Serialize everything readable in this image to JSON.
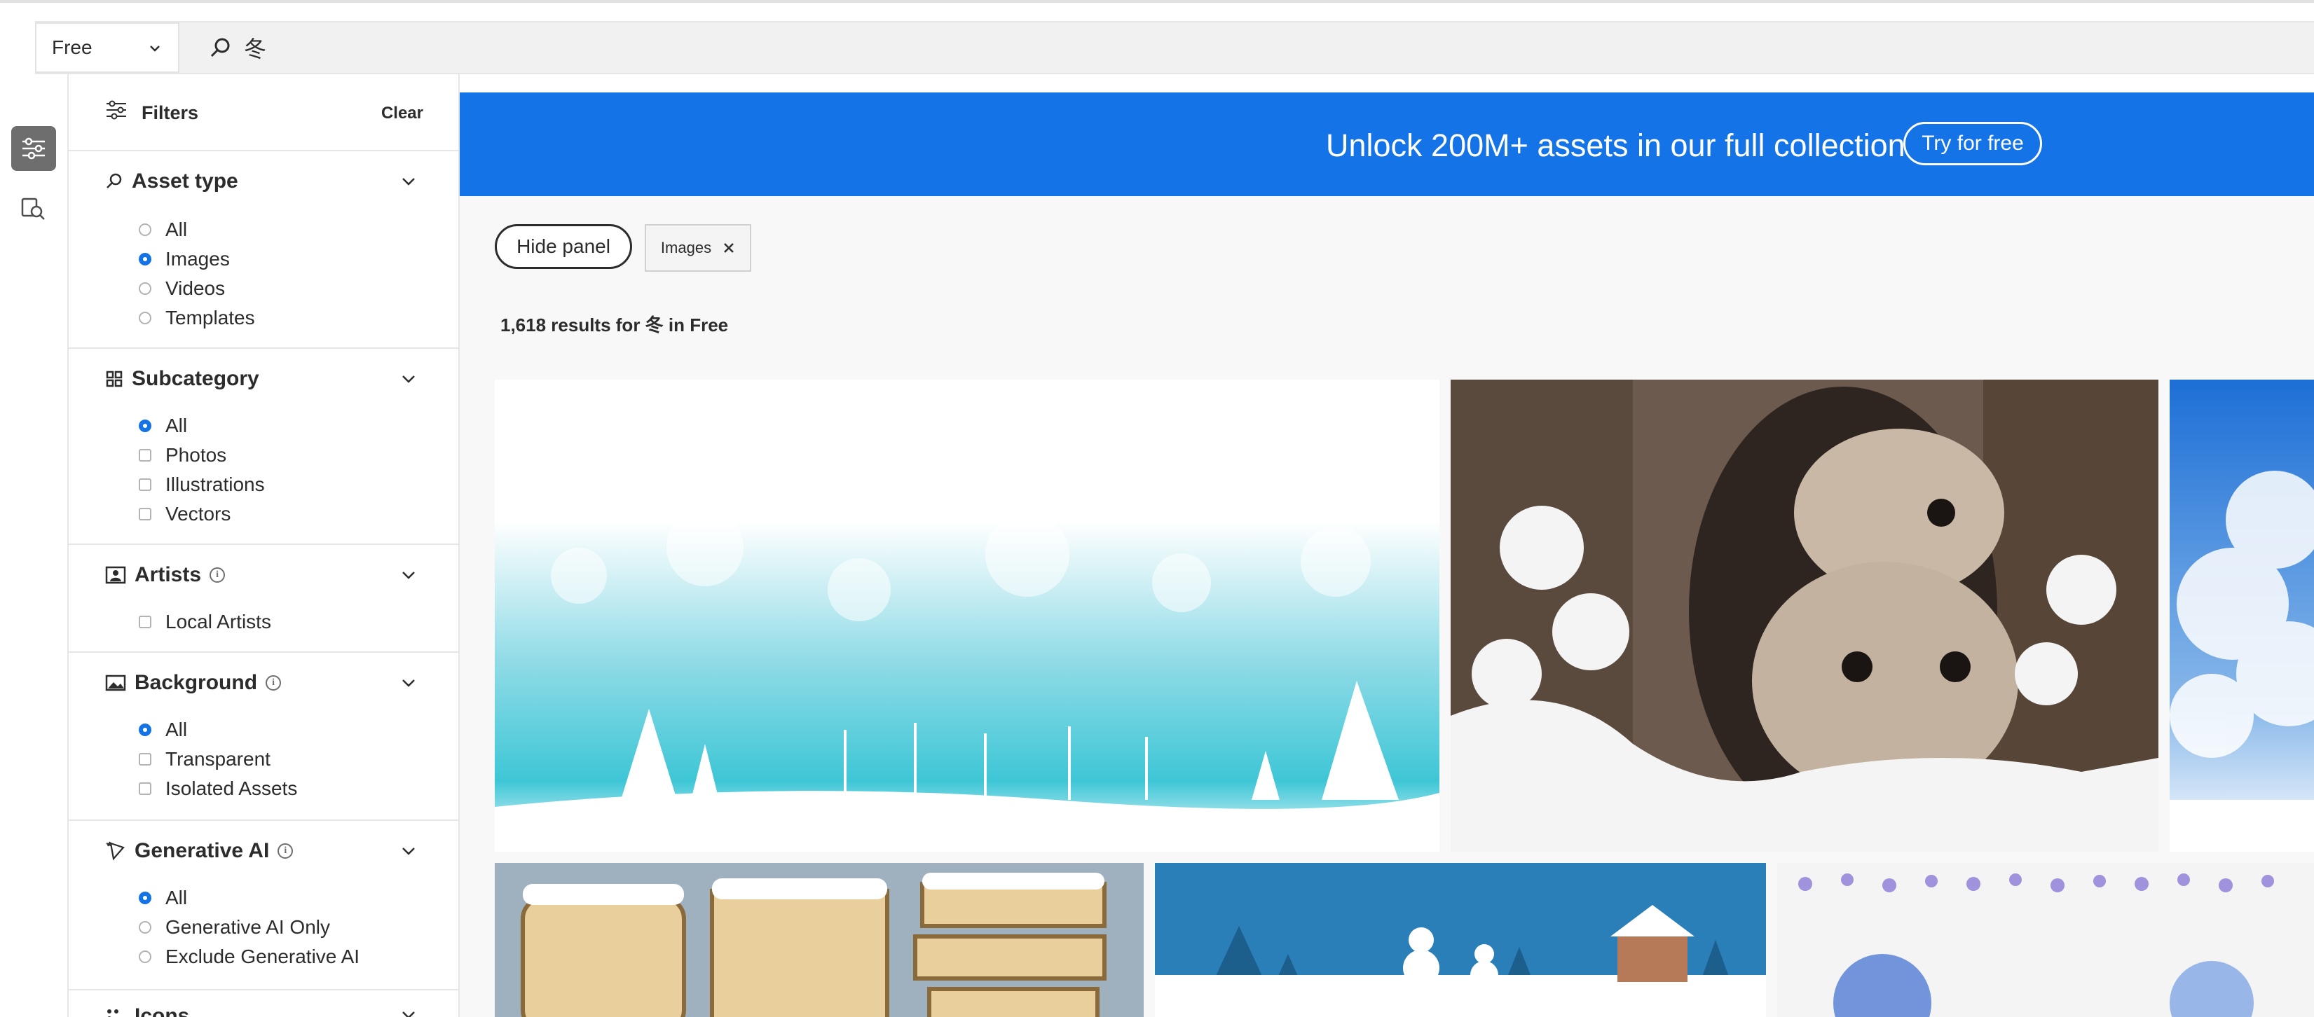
{
  "search": {
    "scope_label": "Free",
    "query": "冬"
  },
  "rail": {
    "filters_icon": "sliders-icon",
    "visual_search_icon": "image-search-icon"
  },
  "filters": {
    "title": "Filters",
    "clear_label": "Clear",
    "sections": {
      "asset_type": {
        "title": "Asset type",
        "options": [
          "All",
          "Images",
          "Videos",
          "Templates"
        ],
        "selected": "Images"
      },
      "subcategory": {
        "title": "Subcategory",
        "options": [
          "All",
          "Photos",
          "Illustrations",
          "Vectors"
        ],
        "selected": "All"
      },
      "artists": {
        "title": "Artists",
        "options": [
          "Local Artists"
        ]
      },
      "background": {
        "title": "Background",
        "options": [
          "All",
          "Transparent",
          "Isolated Assets"
        ],
        "selected": "All"
      },
      "generative_ai": {
        "title": "Generative AI",
        "options": [
          "All",
          "Generative AI Only",
          "Exclude Generative AI"
        ],
        "selected": "All"
      },
      "icons": {
        "title": "Icons"
      }
    }
  },
  "banner": {
    "text": "Unlock 200M+ assets in our full collection",
    "button_label": "Try for free",
    "color": "#1473e6"
  },
  "toolbar": {
    "hide_panel_label": "Hide panel",
    "chip_label": "Images"
  },
  "results": {
    "summary": "1,618 results for 冬 in Free"
  }
}
